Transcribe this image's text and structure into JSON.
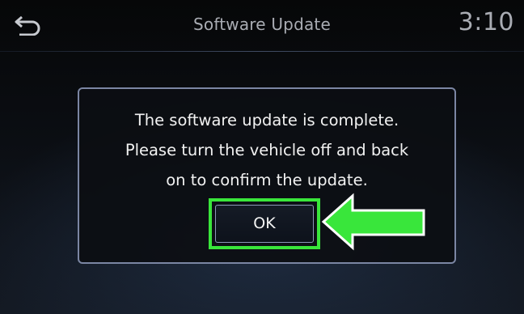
{
  "header": {
    "back_icon": "back-return-icon",
    "title": "Software Update",
    "clock": "3:10"
  },
  "dialog": {
    "message_lines": [
      "The software update is complete.",
      "Please turn the vehicle off and back",
      "on to confirm the update."
    ],
    "ok_label": "OK"
  },
  "annotation": {
    "highlight_color": "#39e63b",
    "arrow_icon": "pointing-arrow-icon",
    "arrow_color": "#39e63b"
  },
  "colors": {
    "background": "#0b0e13",
    "header_text": "#a9acb3",
    "dialog_border": "#7b86a3",
    "message_text": "#f2f2f2"
  }
}
